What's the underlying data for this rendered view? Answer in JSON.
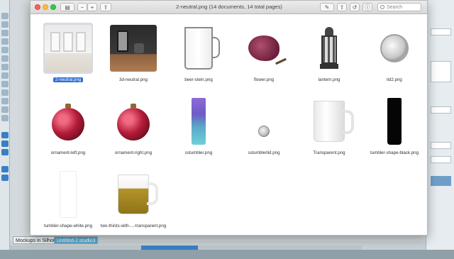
{
  "background_app": {
    "bottom_tabs": [
      "Mockups in Silhou...",
      "Untitled-2.studio3"
    ],
    "active_tab_index": 1
  },
  "quicklook": {
    "title": "2-neutral.png (14 documents, 14 total pages)",
    "search_placeholder": "Search",
    "items": [
      {
        "label": "2-neutral.png",
        "icon": "room-neutral",
        "selected": true
      },
      {
        "label": "3d-neutral.png",
        "icon": "room-dark",
        "selected": false
      },
      {
        "label": "beer-stein.png",
        "icon": "beer-stein",
        "selected": false
      },
      {
        "label": "flower.png",
        "icon": "flower",
        "selected": false
      },
      {
        "label": "lantern.png",
        "icon": "lantern",
        "selected": false
      },
      {
        "label": "lid2.png",
        "icon": "lid",
        "selected": false
      },
      {
        "label": "ornament-left.png",
        "icon": "ornament",
        "selected": false
      },
      {
        "label": "ornament-right.png",
        "icon": "ornament",
        "selected": false
      },
      {
        "label": "sstumbler.png",
        "icon": "tumbler",
        "selected": false
      },
      {
        "label": "sstumblerlid.png",
        "icon": "small-lid",
        "selected": false
      },
      {
        "label": "Transparent.png",
        "icon": "white-mug",
        "selected": false
      },
      {
        "label": "tumbler-shape-black.png",
        "icon": "black-tumbler",
        "selected": false
      },
      {
        "label": "tumbler-shape-white.png",
        "icon": "white-tumbler",
        "selected": false
      },
      {
        "label": "two-thirds-with-...-transparent.png",
        "icon": "gold-mug",
        "selected": false
      }
    ]
  },
  "colors": {
    "selection": "#2f6fd6",
    "active_tab": "#5aa8cf",
    "scroll_thumb": "#3a7fc4"
  }
}
